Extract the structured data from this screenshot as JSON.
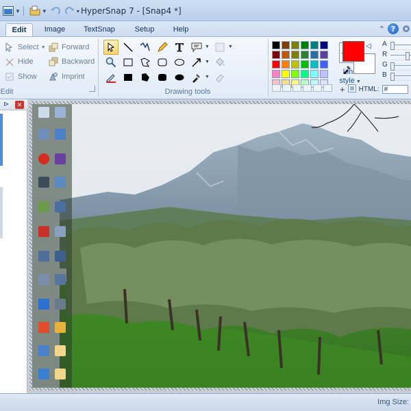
{
  "window": {
    "title": "HyperSnap 7 - [Snap4 *]"
  },
  "tabs": [
    {
      "label": "Edit",
      "active": true
    },
    {
      "label": "Image",
      "active": false
    },
    {
      "label": "TextSnap",
      "active": false
    },
    {
      "label": "Setup",
      "active": false
    },
    {
      "label": "Help",
      "active": false
    }
  ],
  "ribbon": {
    "edit_group": {
      "label": "Edit",
      "select": "Select",
      "hide": "Hide",
      "show": "Show",
      "forward": "Forward",
      "backward": "Backward",
      "imprint": "Imprint"
    },
    "drawing_group": {
      "label": "Drawing tools",
      "line_style_1": "Line",
      "line_style_2": "style"
    },
    "color_group": {
      "channel_a": "A",
      "channel_r": "R",
      "channel_g": "G",
      "channel_b": "B",
      "html_label": "HTML:",
      "html_value": "#",
      "foreground": "#ff0000",
      "background": "#ffffff",
      "palette": [
        "#000000",
        "#7f3f00",
        "#7f7f00",
        "#007f00",
        "#007f7f",
        "#00007f",
        "#7f0000",
        "#c05a00",
        "#808000",
        "#2f7f2f",
        "#2a6f9f",
        "#5a3f9f",
        "#ff0000",
        "#ff8000",
        "#c0c000",
        "#00c000",
        "#00c0c0",
        "#4060ff",
        "#ff80c0",
        "#ffff00",
        "#80ff00",
        "#00ff80",
        "#80ffff",
        "#c0c0ff",
        "#ffc0c0",
        "#ffe080",
        "#ffff80",
        "#c0ffc0",
        "#c0ffff",
        "#e0e0ff"
      ]
    }
  },
  "statusbar": {
    "text": "Img Size:"
  }
}
